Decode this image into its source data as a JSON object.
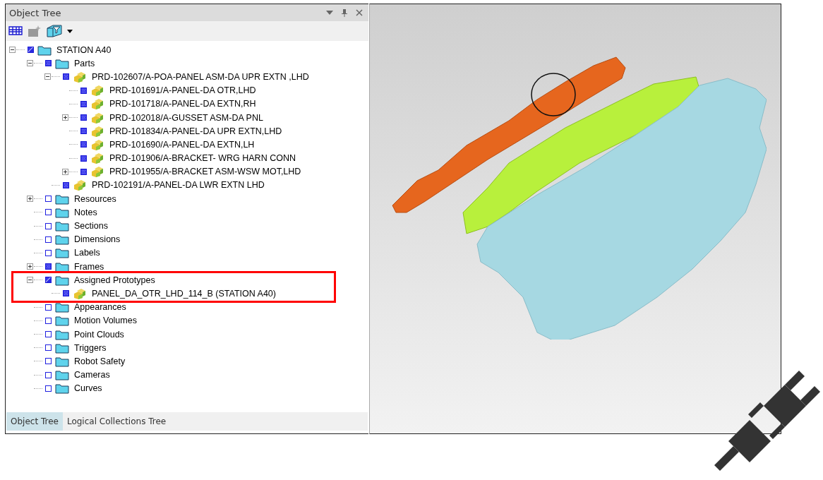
{
  "panel": {
    "title": "Object Tree"
  },
  "tree": [
    {
      "label": "STATION A40",
      "kind": "folder",
      "checked": true,
      "mixed": true,
      "expanded": true,
      "children": [
        {
          "label": "Parts",
          "kind": "folder",
          "checked": true,
          "mixed": false,
          "expanded": true,
          "children": [
            {
              "label": "PRD-102607/A-POA-PANEL ASM-DA UPR EXTN ,LHD",
              "kind": "part",
              "checked": true,
              "mixed": false,
              "expanded": true,
              "children": [
                {
                  "label": "PRD-101691/A-PANEL-DA OTR,LHD",
                  "kind": "part",
                  "checked": true,
                  "mixed": false
                },
                {
                  "label": "PRD-101718/A-PANEL-DA EXTN,RH",
                  "kind": "part",
                  "checked": true,
                  "mixed": false
                },
                {
                  "label": "PRD-102018/A-GUSSET ASM-DA PNL",
                  "kind": "part",
                  "checked": true,
                  "mixed": false,
                  "expanded": false
                },
                {
                  "label": "PRD-101834/A-PANEL-DA UPR EXTN,LHD",
                  "kind": "part",
                  "checked": true,
                  "mixed": false
                },
                {
                  "label": "PRD-101690/A-PANEL-DA EXTN,LH",
                  "kind": "part",
                  "checked": true,
                  "mixed": false
                },
                {
                  "label": "PRD-101906/A-BRACKET- WRG HARN CONN",
                  "kind": "part",
                  "checked": true,
                  "mixed": false
                },
                {
                  "label": "PRD-101955/A-BRACKET ASM-WSW MOT,LHD",
                  "kind": "part",
                  "checked": true,
                  "mixed": false,
                  "expanded": false
                }
              ]
            },
            {
              "label": "PRD-102191/A-PANEL-DA LWR EXTN LHD",
              "kind": "part",
              "checked": true,
              "mixed": false
            }
          ]
        },
        {
          "label": "Resources",
          "kind": "folder",
          "checked": false,
          "mixed": false,
          "expanded": false
        },
        {
          "label": "Notes",
          "kind": "folder",
          "checked": false,
          "mixed": false
        },
        {
          "label": "Sections",
          "kind": "folder",
          "checked": false,
          "mixed": false
        },
        {
          "label": "Dimensions",
          "kind": "folder",
          "checked": false,
          "mixed": false
        },
        {
          "label": "Labels",
          "kind": "folder",
          "checked": false,
          "mixed": false
        },
        {
          "label": "Frames",
          "kind": "folder",
          "checked": true,
          "mixed": false,
          "expanded": false
        },
        {
          "label": "Assigned Prototypes",
          "kind": "folder",
          "checked": true,
          "mixed": true,
          "expanded": true,
          "highlighted": true,
          "children": [
            {
              "label": "PANEL_DA_OTR_LHD_114_B (STATION A40)",
              "kind": "part",
              "checked": true,
              "mixed": false
            }
          ]
        },
        {
          "label": "Appearances",
          "kind": "folder",
          "checked": false,
          "mixed": false
        },
        {
          "label": "Motion Volumes",
          "kind": "folder",
          "checked": false,
          "mixed": false
        },
        {
          "label": "Point Clouds",
          "kind": "folder",
          "checked": false,
          "mixed": false
        },
        {
          "label": "Triggers",
          "kind": "folder",
          "checked": false,
          "mixed": false
        },
        {
          "label": "Robot Safety",
          "kind": "folder",
          "checked": false,
          "mixed": false
        },
        {
          "label": "Cameras",
          "kind": "folder",
          "checked": false,
          "mixed": false
        },
        {
          "label": "Curves",
          "kind": "folder",
          "checked": false,
          "mixed": false
        }
      ]
    }
  ],
  "bottom_tabs": [
    {
      "label": "Object Tree",
      "selected": true
    },
    {
      "label": "Logical Collections Tree",
      "selected": false
    }
  ]
}
